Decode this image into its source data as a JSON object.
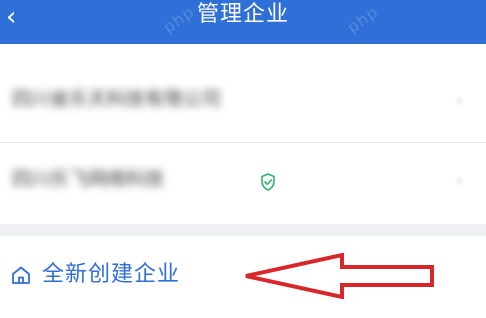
{
  "header": {
    "back_icon": "chevron-left-icon",
    "title": "管理企业",
    "watermarks": [
      "php",
      "php",
      "php",
      "php"
    ]
  },
  "enterprise_list": {
    "items": [
      {
        "name": "四川省乐天科技有限公司",
        "verified": false
      },
      {
        "name": "四川乐飞网络科技",
        "verified": true
      }
    ]
  },
  "create_link": {
    "icon": "home-icon",
    "label": "全新创建企业"
  },
  "annotation": {
    "type": "red-arrow",
    "color": "#d8262b"
  },
  "colors": {
    "brand": "#2f6fd8",
    "verified": "#2fb36a",
    "arrow": "#d8262b"
  }
}
